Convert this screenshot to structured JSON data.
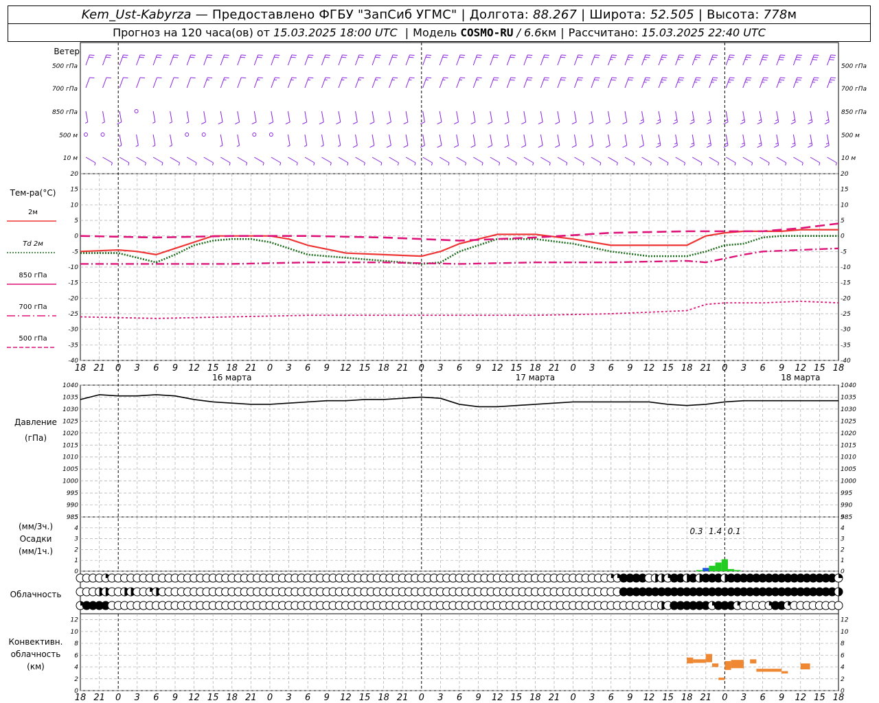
{
  "header": {
    "station": "Kem_Ust-Kabyrza",
    "dash": "—",
    "provider": "Предоставлено ФГБУ \"ЗапСиб УГМС\"",
    "lon_label": "Долгота:",
    "lon_value": "88.267",
    "lat_label": "Широта:",
    "lat_value": "52.505",
    "alt_label": "Высота:",
    "alt_value": "778",
    "alt_unit": "м",
    "forecast_prefix": "Прогноз на 120 часа(ов) от",
    "forecast_start": "15.03.2025 18:00 UTC",
    "model_label": "Модель",
    "model_name": "COSMO-RU",
    "model_res": "/ 6.6",
    "model_res_unit": "км",
    "calc_label": "Рассчитано:",
    "calc_time": "15.03.2025 22:40 UTC"
  },
  "labels": {
    "wind_title": "Ветер",
    "wind_levels": [
      "500 гПа",
      "700 гПа",
      "850 гПа",
      "500  м",
      "10  м"
    ],
    "temp_title": "Тем-ра(°C)",
    "temp_legend": [
      {
        "label": "2м",
        "color": "#ee3333",
        "dash": ""
      },
      {
        "label": "Td  2м",
        "color": "#1a6b1a",
        "dash": "2,2"
      },
      {
        "label": "850 гПа",
        "color": "#dd1177",
        "dash": ""
      },
      {
        "label": "700 гПа",
        "color": "#dd1177",
        "dash": "12,4,2,4"
      },
      {
        "label": "500 гПа",
        "color": "#dd1177",
        "dash": "6,3"
      }
    ],
    "pressure_title": "Давление",
    "pressure_unit": "(гПа)",
    "precip_top": "(мм/3ч.)",
    "precip_title": "Осадки",
    "precip_bottom": "(мм/1ч.)",
    "cloud_title": "Облачность",
    "conv_title1": "Конвективн.",
    "conv_title2": "облачность",
    "conv_unit": "(км)",
    "dates": [
      "16 марта",
      "17 марта",
      "18 марта"
    ],
    "precip_values": [
      "0.3",
      "1.4",
      "0.1"
    ]
  },
  "colors": {
    "wind": "#8822dd",
    "t2m": "#ee3333",
    "td2m": "#1a6b1a",
    "t850": "#dd1177",
    "pressure": "#000000",
    "precip_green": "#22cc22",
    "precip_blue": "#2255dd",
    "conv": "#ee8833",
    "grid": "#aaaaaa"
  },
  "chart_data": [
    {
      "type": "line",
      "panel": "temperature",
      "ylim": [
        -40,
        20
      ],
      "yticks": [
        20,
        15,
        10,
        5,
        0,
        -5,
        -10,
        -15,
        -20,
        -25,
        -30,
        -35,
        -40
      ],
      "x_hours": [
        0,
        6,
        9,
        12,
        15,
        18,
        21,
        24,
        27,
        30,
        33,
        36,
        42,
        48,
        54,
        57,
        60,
        66,
        72,
        78,
        84,
        90,
        96,
        99,
        102,
        105,
        108,
        111,
        114,
        117,
        120
      ],
      "xtick_labels": [
        "18",
        "21",
        "0",
        "3",
        "6",
        "9",
        "12",
        "15",
        "18",
        "21",
        "0",
        "3",
        "6",
        "9",
        "12",
        "15",
        "18",
        "21",
        "0",
        "3",
        "6",
        "9",
        "12",
        "15",
        "18",
        "21",
        "0"
      ],
      "series": [
        {
          "name": "2м",
          "x": [
            0,
            6,
            9,
            12,
            15,
            18,
            21,
            24,
            27,
            30,
            33,
            36,
            42,
            48,
            54,
            57,
            60,
            66,
            72,
            78,
            84,
            90,
            96,
            99,
            102,
            105,
            108,
            111,
            114,
            117,
            120
          ],
          "values": [
            -5,
            -4.5,
            -5,
            -6,
            -4,
            -2,
            0,
            0,
            0,
            0,
            -1,
            -3,
            -5.5,
            -6,
            -6.5,
            -5,
            -2.5,
            0.5,
            0.5,
            -1,
            -3,
            -3,
            -3,
            0,
            1,
            1.5,
            1.5,
            1.5,
            2,
            2,
            2
          ]
        },
        {
          "name": "Td 2м",
          "x": [
            0,
            6,
            9,
            12,
            15,
            18,
            21,
            24,
            27,
            30,
            33,
            36,
            42,
            48,
            54,
            57,
            60,
            66,
            72,
            78,
            84,
            90,
            96,
            99,
            102,
            105,
            108,
            111,
            114,
            117,
            120
          ],
          "values": [
            -5.5,
            -5.5,
            -7,
            -8.5,
            -6,
            -3,
            -1.5,
            -1,
            -1,
            -2,
            -4,
            -6,
            -7,
            -8,
            -9,
            -8.5,
            -5,
            -1,
            -1,
            -2.5,
            -5,
            -6.5,
            -6.5,
            -5,
            -3,
            -2.5,
            -0.5,
            0,
            0,
            0,
            0
          ]
        },
        {
          "name": "850 гПа",
          "x": [
            0,
            12,
            24,
            36,
            48,
            60,
            72,
            84,
            96,
            108,
            114,
            120
          ],
          "values": [
            0,
            -0.5,
            0,
            0,
            -0.5,
            -1.5,
            -0.5,
            1,
            1.5,
            1.5,
            2.5,
            4
          ]
        },
        {
          "name": "700 гПа",
          "x": [
            0,
            12,
            24,
            36,
            48,
            60,
            72,
            84,
            96,
            99,
            105,
            108,
            114,
            120
          ],
          "values": [
            -9,
            -9,
            -9,
            -8.5,
            -8.5,
            -9,
            -8.5,
            -8.5,
            -8,
            -8.5,
            -6,
            -5,
            -4.5,
            -4
          ]
        },
        {
          "name": "500 гПа",
          "x": [
            0,
            12,
            24,
            36,
            48,
            60,
            72,
            84,
            96,
            99,
            102,
            108,
            114,
            120
          ],
          "values": [
            -26,
            -26.5,
            -26,
            -25.5,
            -25.5,
            -25.5,
            -25.5,
            -25,
            -24,
            -22,
            -21.5,
            -21.5,
            -21,
            -21.5
          ]
        }
      ]
    },
    {
      "type": "line",
      "panel": "pressure",
      "ylim": [
        985,
        1040
      ],
      "yticks": [
        1040,
        1035,
        1030,
        1025,
        1020,
        1015,
        1010,
        1005,
        1000,
        995,
        990,
        985
      ],
      "series": [
        {
          "name": "Давление",
          "x": [
            0,
            3,
            6,
            9,
            12,
            15,
            18,
            21,
            24,
            27,
            30,
            33,
            36,
            39,
            42,
            45,
            48,
            51,
            54,
            57,
            60,
            63,
            66,
            69,
            72,
            75,
            78,
            81,
            84,
            87,
            90,
            93,
            96,
            99,
            102,
            105,
            108,
            111,
            114,
            117,
            120
          ],
          "values": [
            1034,
            1036,
            1035.5,
            1035.5,
            1036,
            1035.5,
            1034,
            1033,
            1032.5,
            1032,
            1032,
            1032.5,
            1033,
            1033.5,
            1033.5,
            1034,
            1034,
            1034.5,
            1035,
            1034.5,
            1032,
            1031,
            1031,
            1031.5,
            1032,
            1032.5,
            1033,
            1033,
            1033,
            1033,
            1033,
            1032,
            1031.5,
            1032,
            1033,
            1033.5,
            1033.5,
            1033.5,
            1033.5,
            1033.5,
            1033.5
          ]
        }
      ]
    },
    {
      "type": "bar",
      "panel": "precipitation",
      "ylim": [
        0,
        5
      ],
      "yticks": [
        5,
        4,
        3,
        2,
        1,
        0
      ],
      "bars": [
        {
          "hour": 98,
          "value": 0.1,
          "color": "#22cc22"
        },
        {
          "hour": 99,
          "value": 0.3,
          "color": "#2255dd"
        },
        {
          "hour": 100,
          "value": 0.5,
          "color": "#22cc22"
        },
        {
          "hour": 101,
          "value": 0.8,
          "color": "#22cc22"
        },
        {
          "hour": 102,
          "value": 1.1,
          "color": "#22cc22"
        },
        {
          "hour": 103,
          "value": 0.2,
          "color": "#22cc22"
        },
        {
          "hour": 104,
          "value": 0.1,
          "color": "#22cc22"
        }
      ],
      "sums_3h": [
        {
          "hour": 97.5,
          "label": "0.3"
        },
        {
          "hour": 100.5,
          "label": "1.4"
        },
        {
          "hour": 103.5,
          "label": "0.1"
        }
      ]
    },
    {
      "type": "table",
      "panel": "cloudiness",
      "rows_note": "0=clear,1..3=partial,4=overcast per hour",
      "high": [
        0,
        0,
        0,
        0,
        1,
        0,
        0,
        0,
        0,
        0,
        0,
        0,
        0,
        0,
        0,
        0,
        0,
        0,
        0,
        0,
        0,
        0,
        0,
        0,
        0,
        0,
        0,
        0,
        0,
        0,
        0,
        0,
        0,
        0,
        0,
        0,
        0,
        0,
        0,
        0,
        0,
        0,
        0,
        0,
        0,
        0,
        0,
        0,
        0,
        0,
        0,
        0,
        0,
        0,
        0,
        0,
        0,
        0,
        0,
        0,
        0,
        0,
        0,
        0,
        0,
        0,
        0,
        0,
        0,
        0,
        0,
        0,
        0,
        0,
        0,
        0,
        0,
        0,
        0,
        0,
        0,
        0,
        0,
        0,
        1,
        1,
        4,
        4,
        4,
        4,
        0,
        2,
        2,
        1,
        4,
        4,
        2,
        4,
        2,
        4,
        4,
        4,
        2,
        4,
        4,
        4,
        4,
        4,
        4,
        4,
        4,
        4,
        4,
        4,
        4,
        4,
        4,
        4,
        4,
        4,
        1
      ],
      "mid": [
        0,
        0,
        0,
        2,
        2,
        0,
        0,
        2,
        2,
        0,
        0,
        1,
        2,
        0,
        0,
        0,
        0,
        0,
        0,
        0,
        0,
        0,
        0,
        0,
        0,
        0,
        0,
        0,
        0,
        0,
        0,
        0,
        0,
        0,
        0,
        0,
        0,
        0,
        0,
        0,
        0,
        0,
        0,
        0,
        0,
        0,
        0,
        0,
        0,
        0,
        0,
        0,
        0,
        0,
        0,
        0,
        0,
        0,
        0,
        0,
        0,
        0,
        0,
        0,
        0,
        0,
        0,
        0,
        0,
        0,
        0,
        0,
        0,
        0,
        0,
        0,
        0,
        0,
        0,
        0,
        0,
        0,
        0,
        0,
        0,
        0,
        4,
        4,
        4,
        4,
        4,
        4,
        4,
        4,
        4,
        4,
        4,
        4,
        4,
        4,
        4,
        4,
        4,
        4,
        4,
        4,
        4,
        4,
        4,
        4,
        4,
        4,
        4,
        4,
        4,
        4,
        4,
        4,
        4,
        4,
        2
      ],
      "low": [
        1,
        4,
        4,
        4,
        4,
        0,
        0,
        0,
        0,
        0,
        0,
        0,
        0,
        0,
        0,
        0,
        0,
        0,
        0,
        0,
        0,
        0,
        0,
        0,
        0,
        0,
        0,
        0,
        0,
        0,
        0,
        0,
        0,
        0,
        0,
        0,
        0,
        0,
        0,
        0,
        0,
        0,
        0,
        0,
        0,
        0,
        0,
        0,
        0,
        0,
        0,
        0,
        0,
        0,
        0,
        0,
        0,
        0,
        0,
        0,
        0,
        0,
        0,
        0,
        0,
        0,
        0,
        0,
        0,
        0,
        0,
        0,
        0,
        0,
        0,
        0,
        0,
        0,
        0,
        0,
        0,
        0,
        0,
        0,
        0,
        0,
        0,
        0,
        0,
        0,
        0,
        0,
        2,
        0,
        4,
        4,
        4,
        4,
        4,
        4,
        1,
        4,
        4,
        4,
        1,
        0,
        0,
        0,
        0,
        1,
        4,
        4,
        1,
        0,
        0,
        0,
        0,
        0,
        0,
        0,
        0
      ]
    },
    {
      "type": "bar",
      "panel": "convective_cloud",
      "ylim": [
        0,
        13
      ],
      "yticks": [
        12,
        10,
        8,
        6,
        4,
        2,
        0
      ],
      "segments": [
        {
          "h0": 96,
          "h1": 97,
          "bottom": 4.6,
          "top": 5.6
        },
        {
          "h0": 97,
          "h1": 99,
          "bottom": 4.7,
          "top": 5.3
        },
        {
          "h0": 99,
          "h1": 100,
          "bottom": 4.8,
          "top": 6.2
        },
        {
          "h0": 100,
          "h1": 101,
          "bottom": 4.0,
          "top": 4.6
        },
        {
          "h0": 101,
          "h1": 102,
          "bottom": 1.8,
          "top": 2.2
        },
        {
          "h0": 102,
          "h1": 103,
          "bottom": 3.5,
          "top": 5.0
        },
        {
          "h0": 103,
          "h1": 105,
          "bottom": 3.8,
          "top": 5.2
        },
        {
          "h0": 106,
          "h1": 107,
          "bottom": 4.6,
          "top": 5.3
        },
        {
          "h0": 107,
          "h1": 111,
          "bottom": 3.2,
          "top": 3.7
        },
        {
          "h0": 111,
          "h1": 112,
          "bottom": 2.9,
          "top": 3.3
        },
        {
          "h0": 114,
          "h1": 115.5,
          "bottom": 3.6,
          "top": 4.6
        }
      ]
    },
    {
      "type": "scatter",
      "panel": "wind",
      "levels": [
        "500 гПа",
        "700 гПа",
        "850 гПа",
        "500 м",
        "10 м"
      ],
      "speed_kt": [
        [
          20,
          20,
          20,
          20,
          20,
          20,
          20,
          20,
          20,
          20,
          20,
          20,
          20,
          20,
          20,
          20,
          20,
          20,
          20,
          20,
          20,
          20,
          20,
          20,
          20,
          20,
          20,
          20,
          20,
          20,
          20,
          25,
          25,
          25,
          25,
          25,
          25,
          25,
          25,
          25,
          30,
          30,
          30,
          30,
          30
        ],
        [
          10,
          10,
          10,
          10,
          10,
          10,
          10,
          15,
          15,
          10,
          15,
          15,
          15,
          15,
          15,
          15,
          15,
          15,
          15,
          15,
          15,
          15,
          15,
          15,
          20,
          20,
          20,
          20,
          20,
          20,
          20,
          20,
          20,
          25,
          25,
          25,
          25,
          25,
          25,
          25,
          25,
          25,
          25,
          25,
          25
        ],
        [
          5,
          5,
          10,
          0,
          5,
          5,
          5,
          10,
          10,
          10,
          10,
          10,
          10,
          10,
          10,
          10,
          10,
          10,
          10,
          10,
          10,
          10,
          10,
          10,
          10,
          10,
          10,
          10,
          10,
          10,
          10,
          10,
          10,
          15,
          15,
          15,
          15,
          15,
          15,
          15,
          15,
          15,
          15,
          15,
          15
        ],
        [
          0,
          0,
          5,
          5,
          5,
          5,
          0,
          0,
          5,
          5,
          0,
          0,
          5,
          5,
          5,
          5,
          10,
          10,
          10,
          10,
          10,
          10,
          10,
          10,
          10,
          10,
          10,
          10,
          10,
          10,
          10,
          10,
          10,
          10,
          15,
          15,
          15,
          15,
          15,
          15,
          15,
          15,
          15,
          15,
          15
        ],
        [
          5,
          5,
          5,
          5,
          5,
          5,
          5,
          5,
          5,
          5,
          5,
          5,
          5,
          5,
          5,
          5,
          5,
          5,
          5,
          5,
          5,
          5,
          5,
          5,
          5,
          5,
          5,
          5,
          5,
          5,
          5,
          5,
          5,
          5,
          5,
          5,
          5,
          5,
          5,
          5,
          5,
          5,
          5,
          5,
          5
        ]
      ]
    }
  ]
}
